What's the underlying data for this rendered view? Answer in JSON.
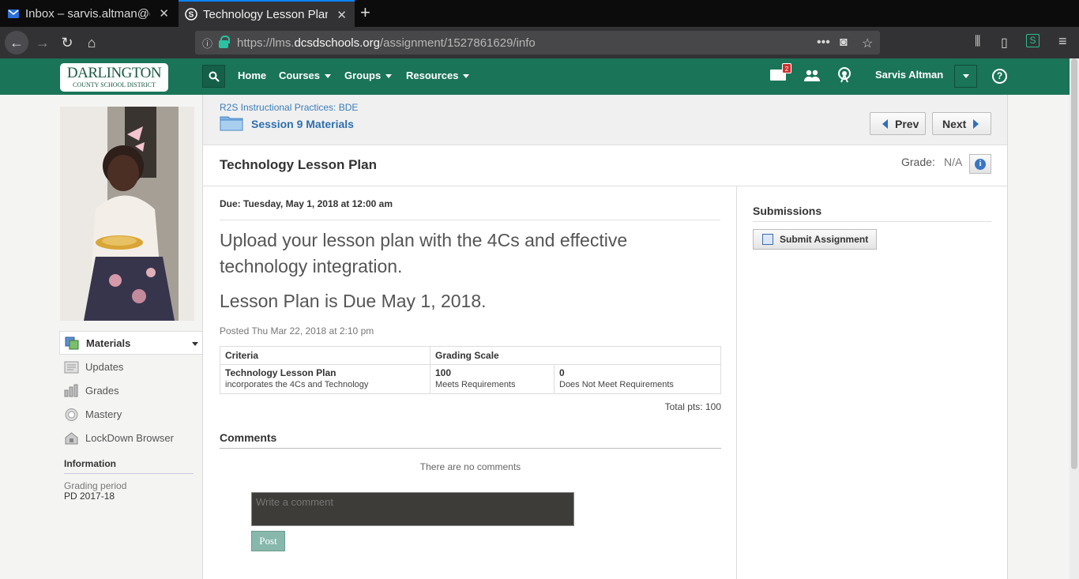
{
  "browser": {
    "tabs": [
      {
        "label": "Inbox – sarvis.altman@dar",
        "icon": "mail-icon"
      },
      {
        "label": "Technology Lesson Plan | ",
        "icon": "schoology-icon"
      }
    ],
    "url_prefix": "https://lms.",
    "url_domain": "dcsdschools.org",
    "url_path": "/assignment/1527861629/info"
  },
  "appbar": {
    "logo_main": "DARLINGTON",
    "logo_sub": "COUNTY SCHOOL DISTRICT",
    "nav": [
      "Home",
      "Courses",
      "Groups",
      "Resources"
    ],
    "mail_count": "2",
    "user_name": "Sarvis Altman",
    "help": "?"
  },
  "sidebar": {
    "items": [
      {
        "label": "Materials",
        "icon": "materials-icon"
      },
      {
        "label": "Updates",
        "icon": "updates-icon"
      },
      {
        "label": "Grades",
        "icon": "grades-icon"
      },
      {
        "label": "Mastery",
        "icon": "mastery-icon"
      },
      {
        "label": "LockDown Browser",
        "icon": "lockdown-icon"
      }
    ],
    "info_heading": "Information",
    "grading_period_label": "Grading period",
    "grading_period_value": "PD 2017-18"
  },
  "header": {
    "breadcrumb": "R2S Instructional Practices: BDE",
    "folder": "Session 9 Materials",
    "prev": "Prev",
    "next": "Next"
  },
  "assignment": {
    "title": "Technology Lesson Plan",
    "grade_label": "Grade:",
    "grade_value": "N/A",
    "due": "Due: Tuesday, May 1, 2018 at 12:00 am",
    "description_1": "Upload your lesson plan with the 4Cs and effective technology integration.",
    "description_2": "Lesson Plan is Due May 1, 2018.",
    "posted": "Posted Thu Mar 22, 2018 at 2:10 pm",
    "rubric": {
      "headers": [
        "Criteria",
        "Grading Scale"
      ],
      "rows": [
        {
          "criterion": "Technology Lesson Plan",
          "criterion_desc": "incorporates the 4Cs and Technology",
          "levels": [
            {
              "points": "100",
              "label": "Meets Requirements"
            },
            {
              "points": "0",
              "label": "Does Not Meet Requirements"
            }
          ]
        }
      ]
    },
    "total_pts": "Total pts: 100"
  },
  "comments": {
    "heading": "Comments",
    "empty": "There are no comments",
    "placeholder": "Write a comment",
    "post_label": "Post"
  },
  "submissions": {
    "heading": "Submissions",
    "submit_label": "Submit Assignment"
  }
}
